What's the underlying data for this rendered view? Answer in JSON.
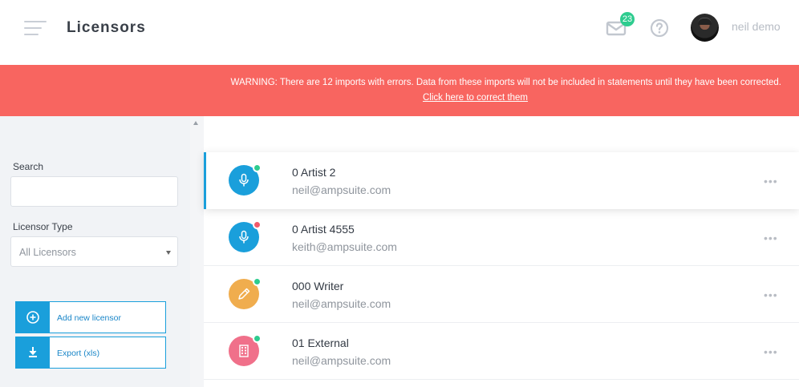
{
  "header": {
    "title": "Licensors",
    "mail_count": "23",
    "user_name": "neil demo"
  },
  "banner": {
    "warning": "WARNING: There are 12 imports with errors. Data from these imports will not be included in statements until they have been corrected.",
    "link": "Click here to correct them"
  },
  "sidebar": {
    "search_label": "Search",
    "search_value": "",
    "type_label": "Licensor Type",
    "type_value": "All Licensors",
    "add_label": "Add new licensor",
    "export_label": "Export (xls)"
  },
  "licensors": [
    {
      "name": "0 Artist 2",
      "email": "neil@ampsuite.com",
      "icon": "microphone-icon",
      "color": "#1a9fdb",
      "status": "#2ecc8f"
    },
    {
      "name": "0 Artist 4555",
      "email": "keith@ampsuite.com",
      "icon": "microphone-icon",
      "color": "#1a9fdb",
      "status": "#f25a6a"
    },
    {
      "name": "000 Writer",
      "email": "neil@ampsuite.com",
      "icon": "pen-icon",
      "color": "#f0ad4e",
      "status": "#2ecc8f"
    },
    {
      "name": "01 External",
      "email": "neil@ampsuite.com",
      "icon": "building-icon",
      "color": "#f0708a",
      "status": "#2ecc8f"
    }
  ],
  "more_label": "•••"
}
